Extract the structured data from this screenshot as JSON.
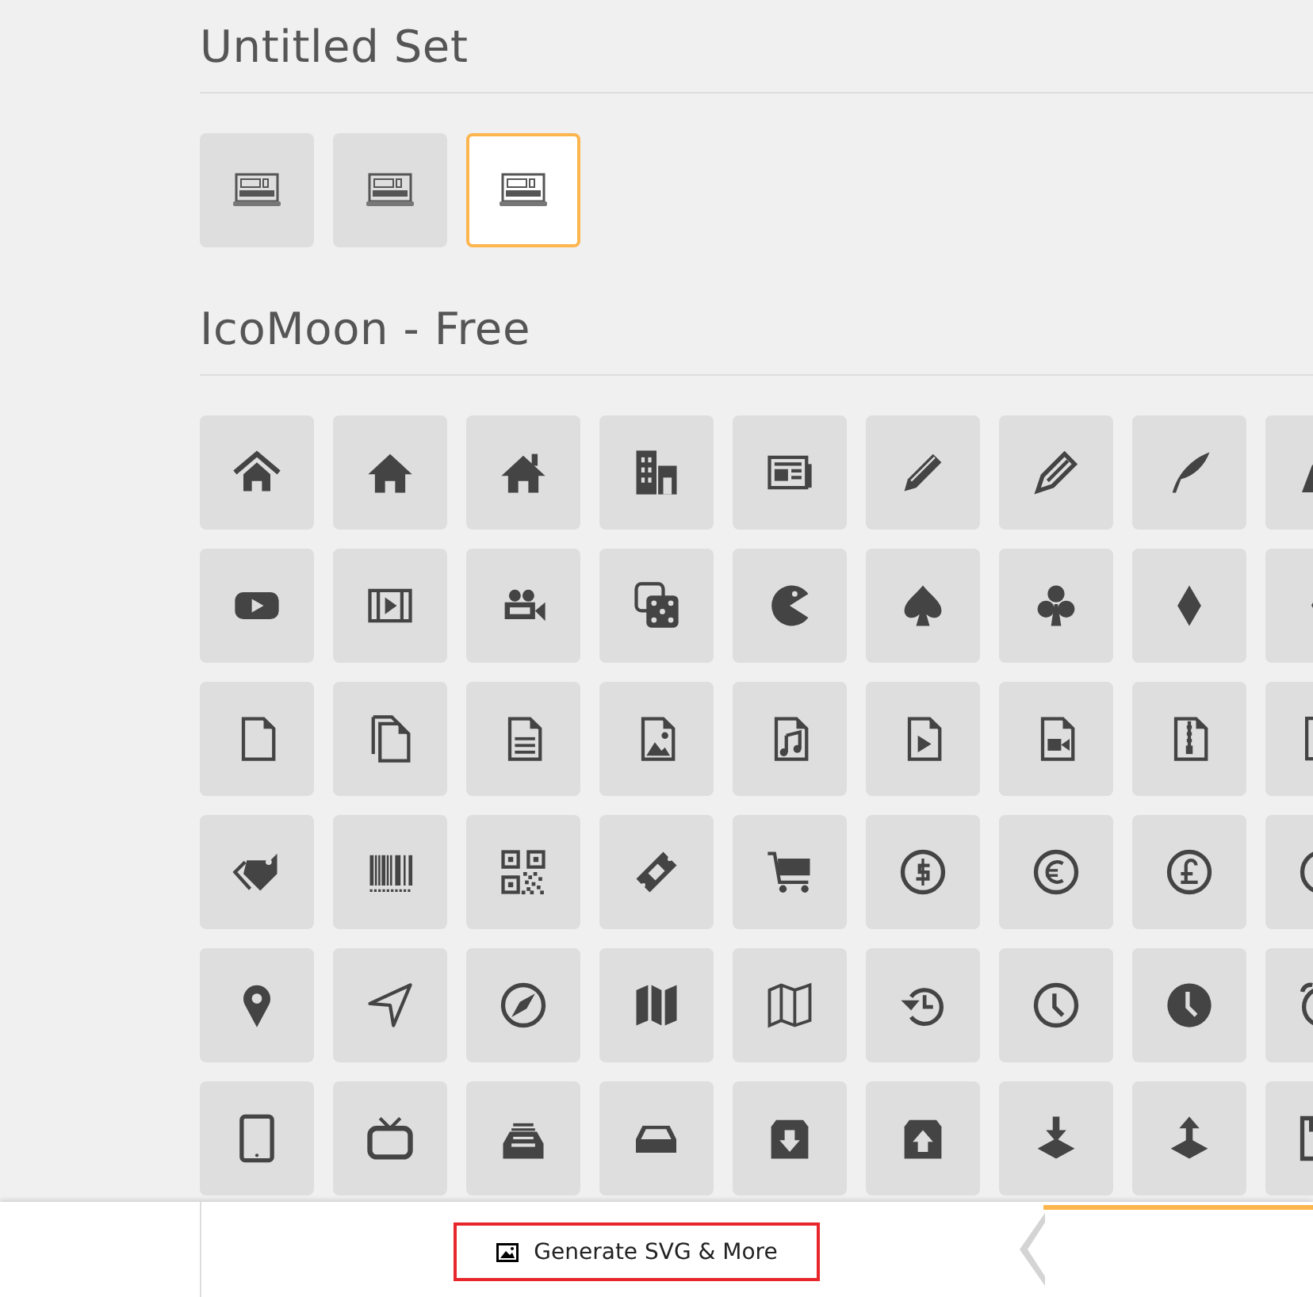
{
  "untitled_set": {
    "title": "Untitled Set",
    "items": [
      {
        "selected": false
      },
      {
        "selected": false
      },
      {
        "selected": true
      }
    ]
  },
  "icomoon_free": {
    "title": "IcoMoon - Free"
  },
  "bottom_bar": {
    "generate_button": "Generate SVG & More"
  }
}
